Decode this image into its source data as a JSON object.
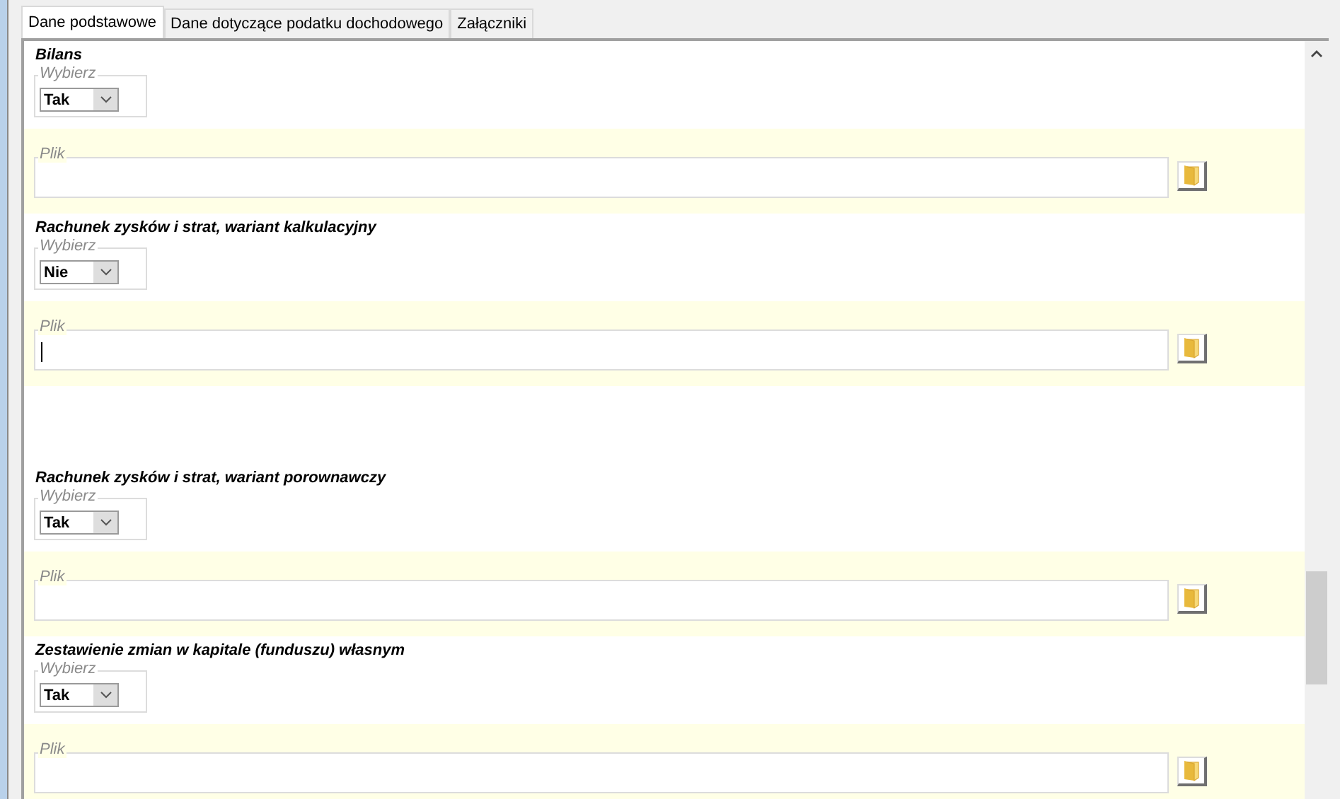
{
  "tabs": [
    {
      "label": "Dane podstawowe",
      "selected": true
    },
    {
      "label": "Dane dotyczące podatku dochodowego",
      "selected": false
    },
    {
      "label": "Załączniki",
      "selected": false
    }
  ],
  "sections": [
    {
      "title": "Bilans",
      "choice_legend": "Wybierz",
      "choice": "Tak",
      "file_legend": "Plik",
      "file_focused": false
    },
    {
      "title": "Rachunek zysków i strat, wariant kalkulacyjny",
      "choice_legend": "Wybierz",
      "choice": "Nie",
      "file_legend": "Plik",
      "file_focused": true
    },
    {
      "title": "Rachunek zysków i strat, wariant porownawczy",
      "choice_legend": "Wybierz",
      "choice": "Tak",
      "file_legend": "Plik",
      "file_focused": false
    },
    {
      "title": "Zestawienie zmian w kapitale (funduszu) własnym",
      "choice_legend": "Wybierz",
      "choice": "Tak",
      "file_legend": "Plik",
      "file_focused": false
    }
  ]
}
